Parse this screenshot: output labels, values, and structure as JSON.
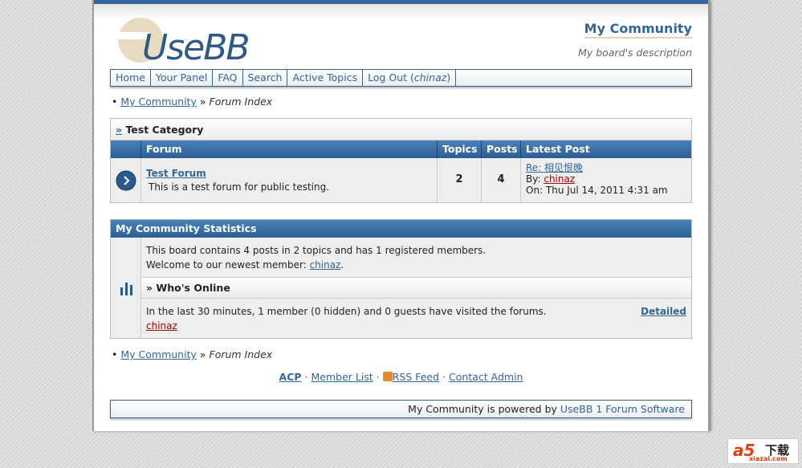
{
  "header": {
    "logo_text": "UseBB",
    "title": "My Community",
    "description": "My board's description"
  },
  "nav": [
    {
      "label": "Home"
    },
    {
      "label": "Your Panel"
    },
    {
      "label": "FAQ"
    },
    {
      "label": "Search"
    },
    {
      "label": "Active Topics"
    },
    {
      "label": "Log Out (",
      "user": "chinaz",
      "close": ")"
    }
  ],
  "breadcrumb": {
    "home": "My Community",
    "sep": "»",
    "current": "Forum Index"
  },
  "category": {
    "marker": "»",
    "name": "Test Category",
    "columns": [
      "Forum",
      "Topics",
      "Posts",
      "Latest Post"
    ],
    "forums": [
      {
        "name": "Test Forum",
        "description": "This is a test forum for public testing.",
        "topics": "2",
        "posts": "4",
        "latest_title": "Re: 相见恨晚",
        "by_label": "By:",
        "by_user": "chinaz",
        "on": "On: Thu Jul 14, 2011 4:31 am"
      }
    ]
  },
  "stats": {
    "title": "My Community Statistics",
    "line1": "This board contains 4 posts in 2 topics and has 1 registered members.",
    "welcome": "Welcome to our newest member:",
    "newest": "chinaz",
    "online_title": "» Who's Online",
    "online_text": "In the last 30 minutes, 1 member (0 hidden) and 0 guests have visited the forums.",
    "detailed": "Detailed",
    "online_user": "chinaz"
  },
  "footer": {
    "links": [
      "ACP",
      "Member List",
      "RSS Feed",
      "Contact Admin"
    ],
    "dot": "·",
    "powered_text": "My Community is powered by",
    "powered_link": "UseBB 1 Forum Software"
  },
  "watermark": {
    "brand": "a5",
    "cn": "下载",
    "site": "xiazai.com"
  }
}
